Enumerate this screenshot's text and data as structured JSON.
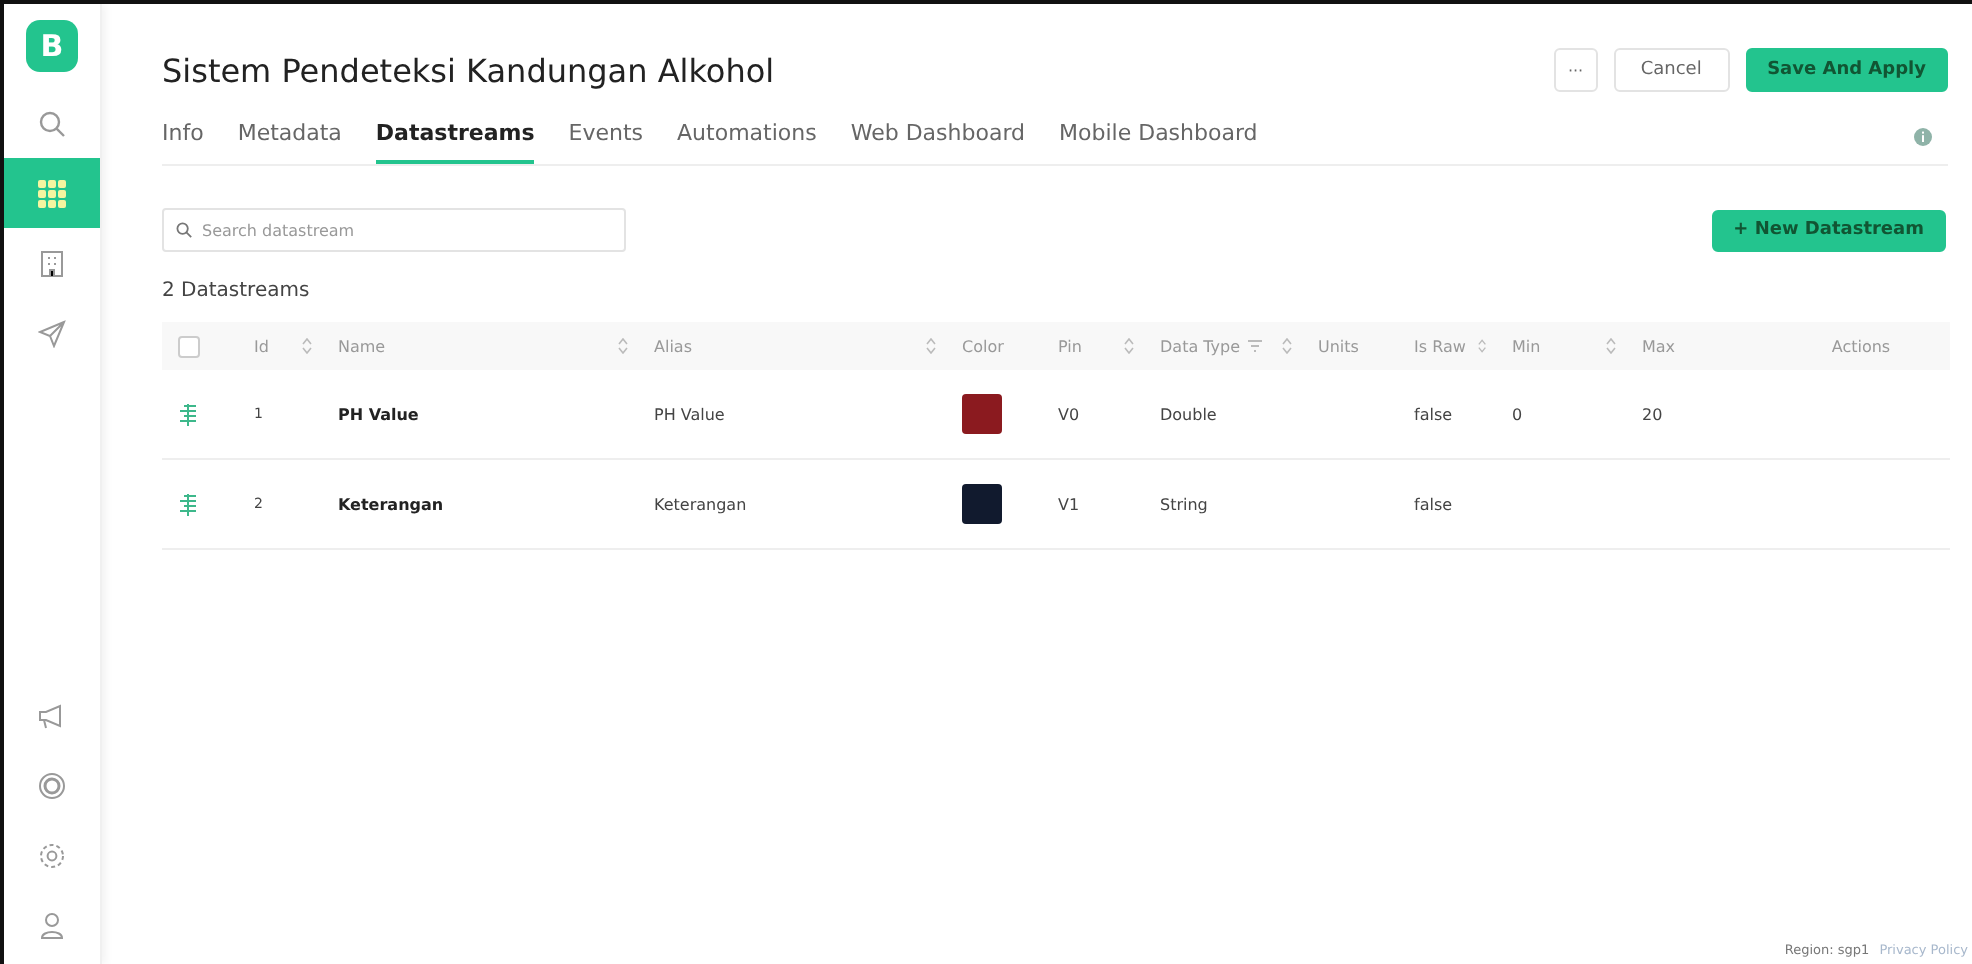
{
  "sidebar": {
    "logo": "B",
    "items": [
      {
        "kind": "search",
        "selected": false
      },
      {
        "kind": "grid",
        "selected": true
      },
      {
        "kind": "building",
        "selected": false
      },
      {
        "kind": "send",
        "selected": false
      }
    ],
    "bottom_items": [
      {
        "kind": "megaphone",
        "selected": false
      },
      {
        "kind": "ring",
        "selected": false
      },
      {
        "kind": "gear",
        "selected": false
      },
      {
        "kind": "user",
        "selected": false
      }
    ]
  },
  "header": {
    "title": "Sistem Pendeteksi Kandungan Alkohol",
    "more_button": "···",
    "cancel_button": "Cancel",
    "save_button": "Save And Apply"
  },
  "tabs": [
    {
      "label": "Info",
      "selected": false
    },
    {
      "label": "Metadata",
      "selected": false
    },
    {
      "label": "Datastreams",
      "selected": true
    },
    {
      "label": "Events",
      "selected": false
    },
    {
      "label": "Automations",
      "selected": false
    },
    {
      "label": "Web Dashboard",
      "selected": false
    },
    {
      "label": "Mobile Dashboard",
      "selected": false
    }
  ],
  "search": {
    "placeholder": "Search datastream"
  },
  "new_button": "+ New Datastream",
  "count": "2 Datastreams",
  "table": {
    "select_all": {
      "checked": false
    },
    "columns": [
      {
        "label": "Id",
        "sortable": true,
        "filter": false
      },
      {
        "label": "Name",
        "sortable": true,
        "filter": false
      },
      {
        "label": "Alias",
        "sortable": true,
        "filter": false
      },
      {
        "label": "Color",
        "sortable": false,
        "filter": false
      },
      {
        "label": "Pin",
        "sortable": true,
        "filter": false
      },
      {
        "label": "Data Type",
        "sortable": true,
        "filter": true
      },
      {
        "label": "Units",
        "sortable": false,
        "filter": false
      },
      {
        "label": "Is Raw",
        "sortable": true,
        "filter": false
      },
      {
        "label": "Min",
        "sortable": true,
        "filter": false
      },
      {
        "label": "Max",
        "sortable": false,
        "filter": false
      },
      {
        "label": "Actions",
        "sortable": false,
        "filter": false
      }
    ],
    "rows": [
      {
        "id": "1",
        "name": "PH Value",
        "alias": "PH Value",
        "color": "#8b1a1f",
        "pin": "V0",
        "data_type": "Double",
        "is_raw": "false",
        "min": "0",
        "max": "20"
      },
      {
        "id": "2",
        "name": "Keterangan",
        "alias": "Keterangan",
        "color": "#111a2e",
        "pin": "V1",
        "data_type": "String",
        "is_raw": "false"
      }
    ]
  },
  "footer": {
    "region": "Region: sgp1",
    "link": "Privacy Policy"
  }
}
